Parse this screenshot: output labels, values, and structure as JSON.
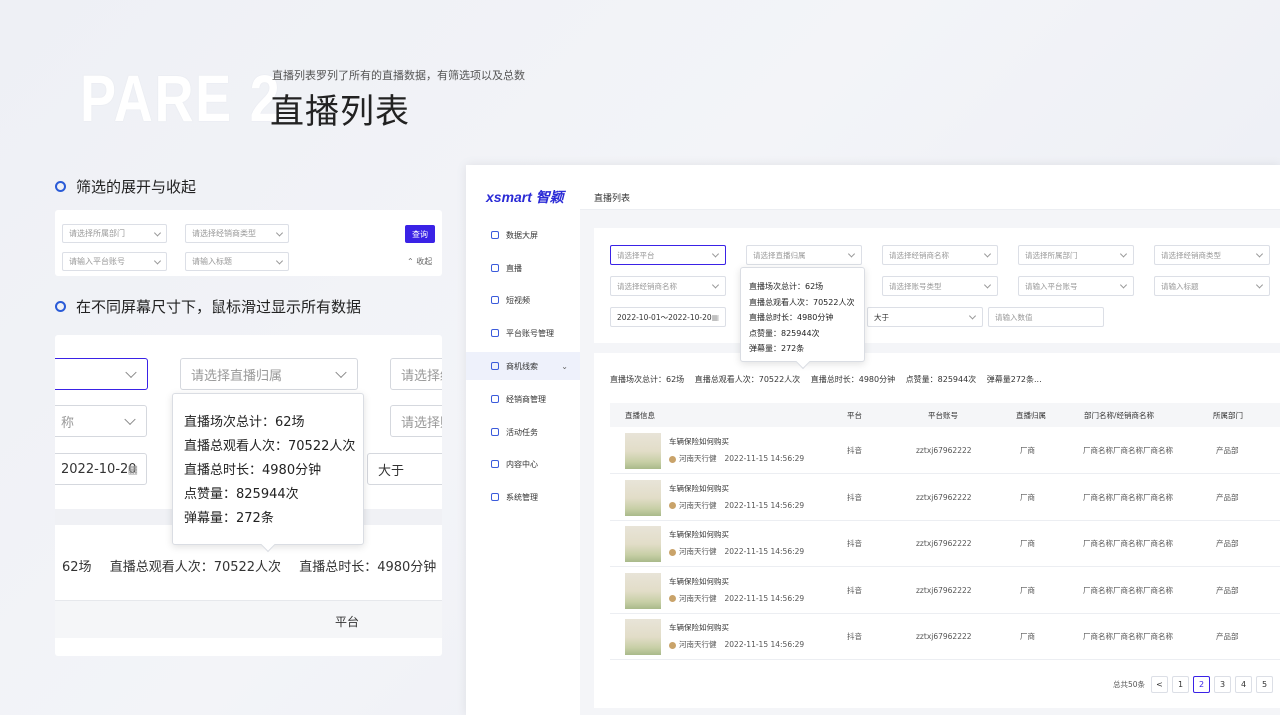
{
  "header": {
    "part": "PARE 2",
    "description": "直播列表罗列了所有的直播数据，有筛选项以及总数",
    "title": "直播列表"
  },
  "section1": {
    "bullet": "筛选的展开与收起",
    "filters": [
      "请选择所属部门",
      "请选择经销商类型",
      "请输入平台账号",
      "请输入标题"
    ],
    "query_button": "查询",
    "collapse_label": "收起"
  },
  "section2": {
    "bullet": "在不同屏幕尺寸下，鼠标滑过显示所有数据",
    "select_partial_left": "",
    "select_belong": "请选择直播归属",
    "select_right1": "请选择经",
    "select_name_partial": "称",
    "select_right2": "请选择账",
    "date_partial": "2022-10-20",
    "greater": "大于",
    "tooltip": [
      "直播场次总计：62场",
      "直播总观看人次：70522人次",
      "直播总时长：4980分钟",
      "点赞量：825944次",
      "弹幕量：272条"
    ],
    "stats_line": [
      "62场",
      "直播总观看人次：70522人次",
      "直播总时长：4980分钟"
    ],
    "col_platform": "平台"
  },
  "app": {
    "logo": "xsmart 智颖",
    "page_title": "直播列表",
    "nav": [
      "数据大屏",
      "直播",
      "短视频",
      "平台账号管理",
      "商机线索",
      "经销商管理",
      "活动任务",
      "内容中心",
      "系统管理"
    ],
    "filters_row1": [
      "请选择平台",
      "请选择直播归属",
      "请选择经销商名称",
      "请选择所属部门",
      "请选择经销商类型"
    ],
    "filters_row2": [
      "请选择经销商名称",
      "请选择账号类型",
      "请输入平台账号",
      "请输入标题"
    ],
    "date_range": "2022-10-01～2022-10-20",
    "greater": "大于",
    "number_placeholder": "请输入数值",
    "tooltip": [
      "直播场次总计：62场",
      "直播总观看人次：70522人次",
      "直播总时长：4980分钟",
      "点赞量：825944次",
      "弹幕量：272条"
    ],
    "summary": {
      "sessions_label": "直播场次总计：",
      "sessions": "62场",
      "views_label": "直播总观看人次：",
      "views": "70522人次",
      "duration_label": "直播总时长：",
      "duration": "4980分钟",
      "likes_label": "点赞量：",
      "likes": "825944次",
      "danmu": "弹幕量272条..."
    },
    "columns": [
      "直播信息",
      "平台",
      "平台账号",
      "直播归属",
      "部门名称/经销商名称",
      "所属部门"
    ],
    "rows": [
      {
        "title": "车辆保险如何购买",
        "author": "河南天行健",
        "time": "2022-11-15 14:56:29",
        "platform": "抖音",
        "account": "zztxj67962222",
        "belong": "厂商",
        "dealer": "厂商名称厂商名称厂商名称",
        "dept": "产品部"
      },
      {
        "title": "车辆保险如何购买",
        "author": "河南天行健",
        "time": "2022-11-15 14:56:29",
        "platform": "抖音",
        "account": "zztxj67962222",
        "belong": "厂商",
        "dealer": "厂商名称厂商名称厂商名称",
        "dept": "产品部"
      },
      {
        "title": "车辆保险如何购买",
        "author": "河南天行健",
        "time": "2022-11-15 14:56:29",
        "platform": "抖音",
        "account": "zztxj67962222",
        "belong": "厂商",
        "dealer": "厂商名称厂商名称厂商名称",
        "dept": "产品部"
      },
      {
        "title": "车辆保险如何购买",
        "author": "河南天行健",
        "time": "2022-11-15 14:56:29",
        "platform": "抖音",
        "account": "zztxj67962222",
        "belong": "厂商",
        "dealer": "厂商名称厂商名称厂商名称",
        "dept": "产品部"
      },
      {
        "title": "车辆保险如何购买",
        "author": "河南天行健",
        "time": "2022-11-15 14:56:29",
        "platform": "抖音",
        "account": "zztxj67962222",
        "belong": "厂商",
        "dealer": "厂商名称厂商名称厂商名称",
        "dept": "产品部"
      }
    ],
    "pagination": {
      "total": "总共50条",
      "prev": "<",
      "pages": [
        "1",
        "2",
        "3",
        "4",
        "5"
      ],
      "current": "2"
    }
  }
}
